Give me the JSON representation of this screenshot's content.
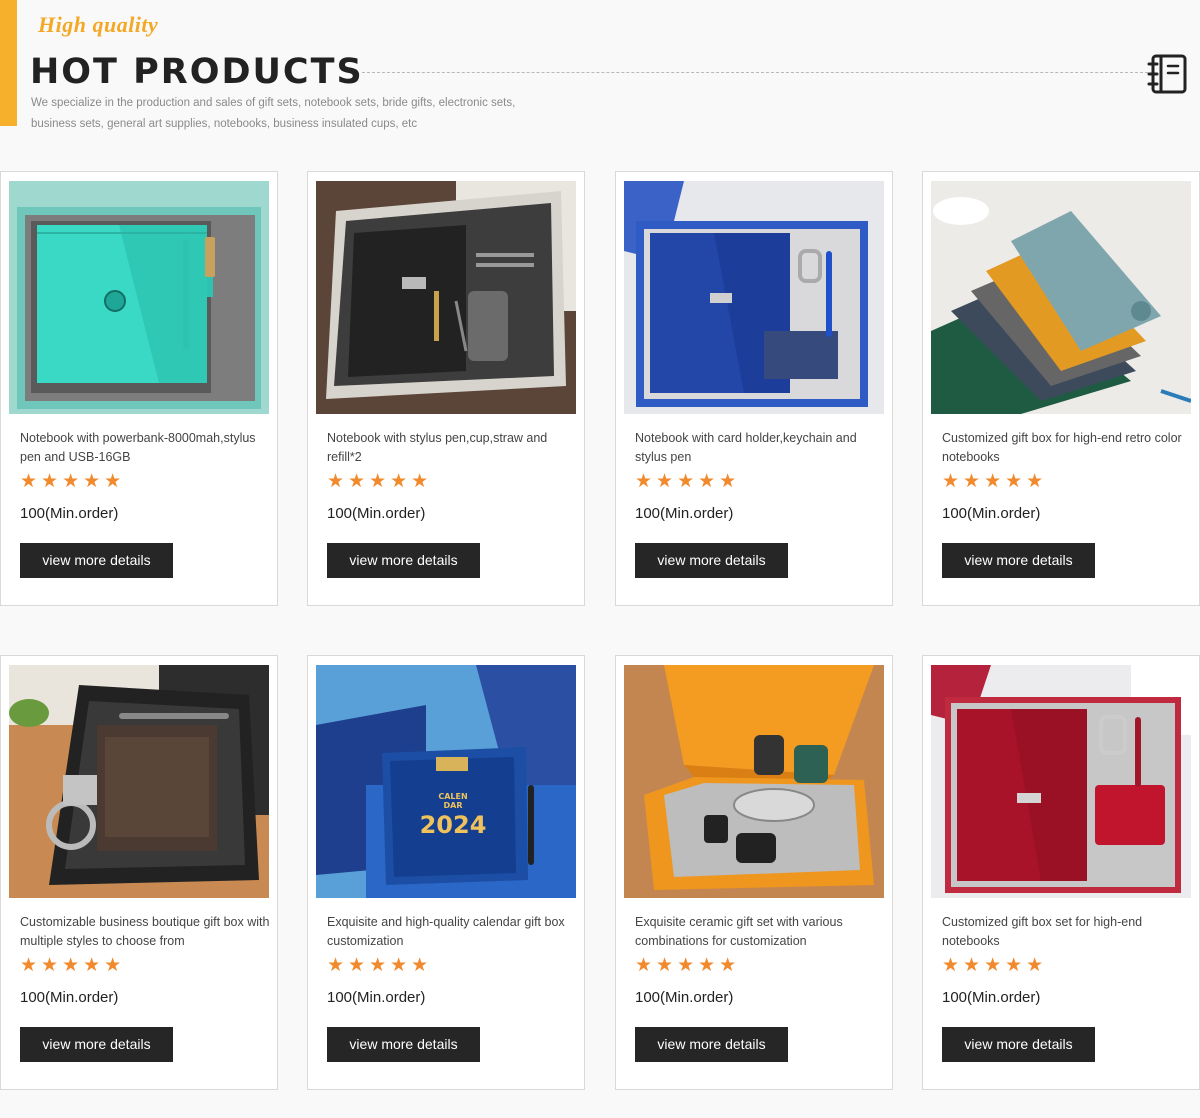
{
  "header": {
    "tagline": "High quality",
    "title": "HOT PRODUCTS",
    "description": "We specialize in the production and sales of gift sets, notebook sets, bride gifts, electronic sets, business sets, general art supplies, notebooks, business insulated cups, etc",
    "icon": "notebook-icon"
  },
  "colors": {
    "accent": "#f7b02c",
    "tagline": "#f4a826",
    "stars": "#f08a2d",
    "button": "#262626"
  },
  "products": [
    {
      "title": "Notebook with powerbank-8000mah,stylus pen and USB-16GB",
      "rating": 5,
      "stars": "★★★★★",
      "moq": "100(Min.order)",
      "button": "view more details"
    },
    {
      "title": "Notebook with stylus pen,cup,straw and refill*2",
      "rating": 5,
      "stars": "★★★★★",
      "moq": "100(Min.order)",
      "button": "view more details"
    },
    {
      "title": "Notebook with card holder,keychain and stylus pen",
      "rating": 5,
      "stars": "★★★★★",
      "moq": "100(Min.order)",
      "button": "view more details"
    },
    {
      "title": "Customized gift box for high-end retro color notebooks",
      "rating": 5,
      "stars": "★★★★★",
      "moq": "100(Min.order)",
      "button": "view more details"
    },
    {
      "title": "Customizable business boutique gift box with multiple styles to choose from",
      "rating": 5,
      "stars": "★★★★★",
      "moq": "100(Min.order)",
      "button": "view more details"
    },
    {
      "title": "Exquisite and high-quality calendar gift box customization",
      "rating": 5,
      "stars": "★★★★★",
      "moq": "100(Min.order)",
      "button": "view more details",
      "image_text": {
        "line1": "CALEN",
        "line2": "DAR",
        "year": "2024"
      }
    },
    {
      "title": "Exquisite ceramic gift set with various combinations for customization",
      "rating": 5,
      "stars": "★★★★★",
      "moq": "100(Min.order)",
      "button": "view more details"
    },
    {
      "title": "Customized gift box set for high-end notebooks",
      "rating": 5,
      "stars": "★★★★★",
      "moq": "100(Min.order)",
      "button": "view more details"
    }
  ]
}
